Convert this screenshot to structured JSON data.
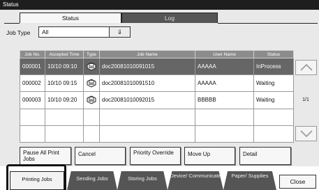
{
  "window": {
    "title": "Status"
  },
  "tabs": [
    {
      "label": "Status",
      "active": true
    },
    {
      "label": "Log",
      "active": false
    }
  ],
  "job_type": {
    "label": "Job Type",
    "value": "All"
  },
  "table": {
    "columns": [
      "Job No.",
      "Accepted Time",
      "Type",
      "Job Name",
      "User Name",
      "Status"
    ],
    "rows": [
      {
        "job_no": "000001",
        "time": "10/10 09:10",
        "type_icon": "print-job-icon",
        "job_name": "doc20081010091015",
        "user": "AAAAA",
        "status": "InProcess",
        "selected": true
      },
      {
        "job_no": "000002",
        "time": "10/10 09:15",
        "type_icon": "print-job-icon",
        "job_name": "doc20081010091510",
        "user": "AAAAA",
        "status": "Waiting",
        "selected": false
      },
      {
        "job_no": "000003",
        "time": "10/10 09:20",
        "type_icon": "print-job-icon",
        "job_name": "doc20081010092015",
        "user": "BBBBB",
        "status": "Waiting",
        "selected": false
      }
    ]
  },
  "pager": {
    "page": "1/1"
  },
  "actions": {
    "pause_all": "Pause All Print Jobs",
    "cancel": "Cancel",
    "priority": "Priority Override",
    "move_up": "Move Up",
    "detail": "Detail"
  },
  "bottom_tabs": {
    "printing": "Printing Jobs",
    "sending": "Sending Jobs",
    "storing": "Storing Jobs",
    "device": "Device/ Communicate",
    "paper": "Paper/ Supplies"
  },
  "close_label": "Close",
  "colors": {
    "title_bar": "#1e1e1e",
    "header": "#8c8c8c",
    "selected_row": "#666666",
    "tab_inactive": "#555555"
  }
}
